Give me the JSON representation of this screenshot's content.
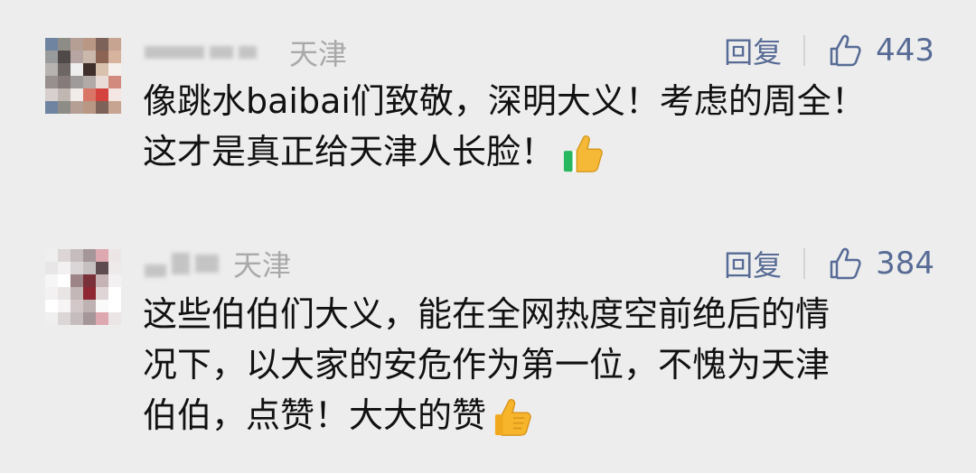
{
  "comments": [
    {
      "username": "",
      "location": "天津",
      "reply_label": "回复",
      "like_count": "443",
      "text_line_1": "像跳水baibai们致敬，深明大义！考虑的周全！",
      "text_line_2": "这才是真正给天津人长脸！",
      "emoji_name": "thumbs-up",
      "avatar_colors": [
        "#6f84a0",
        "#8d8c87",
        "#b59f95",
        "#b89784",
        "#7d6259",
        "#c7a391",
        "#999a9b",
        "#4f4a47",
        "#b6a5a2",
        "#c9b8ab",
        "#8b6454",
        "#d7b29c",
        "#b7b3b1",
        "#6d6664",
        "#eeeeee",
        "#3f302b",
        "#d8c2ad",
        "#f5f0eb",
        "#97908f",
        "#847b7a",
        "#9f9b9a",
        "#b1aaa7",
        "#e9dcd6",
        "#d18a7d",
        "#d7d0ce",
        "#c0b7b3",
        "#f1ecea",
        "#d97667",
        "#d4433e",
        "#f4e7e3"
      ]
    },
    {
      "username": "",
      "location": "天津",
      "reply_label": "回复",
      "like_count": "384",
      "text_line_1": "这些伯伯们大义，能在全网热度空前绝后的情",
      "text_line_2": "况下，以大家的安危作为第一位，不愧为天津",
      "text_line_3": "伯伯，点赞！大大的赞",
      "emoji_name": "thumbs-up",
      "avatar_colors": [
        "#f0efef",
        "#dcd6d6",
        "#c5bcbe",
        "#a5969a",
        "#dea8b0",
        "#ece5e6",
        "#e8e6e6",
        "#f3f1f1",
        "#dad5d6",
        "#c7c0c1",
        "#5d4b50",
        "#eeeaea",
        "#f7f6f6",
        "#ffffff",
        "#9c8487",
        "#7a3039",
        "#c6b3b5",
        "#f3f1f1",
        "#f3f1f1",
        "#e9e5e5",
        "#c4b7b8",
        "#8e2731",
        "#dfd5d6",
        "#ffffff",
        "#ffffff",
        "#f6f4f4",
        "#d2c8c9",
        "#bfb2b3",
        "#fafafa",
        "#ffffff"
      ]
    }
  ]
}
